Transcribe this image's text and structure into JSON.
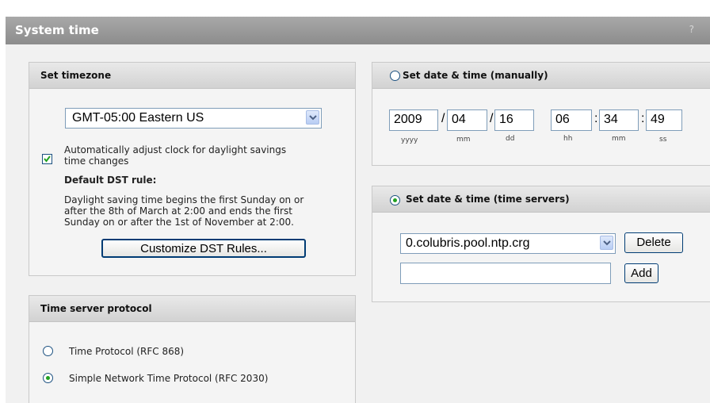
{
  "page": {
    "title": "System time",
    "help": "?"
  },
  "timezone": {
    "title": "Set timezone",
    "selected": "GMT-05:00 Eastern US",
    "auto_adjust_label_1": "Automatically adjust clock for daylight savings",
    "auto_adjust_label_2": "time changes",
    "auto_adjust_checked": true,
    "dst_heading": "Default DST rule:",
    "dst_text_1": "Daylight saving time begins the first Sunday on or",
    "dst_text_2": "after the 8th of March at 2:00 and ends the first",
    "dst_text_3": "Sunday on or after the 1st of November at 2:00.",
    "customize_button": "Customize DST Rules..."
  },
  "protocol": {
    "title": "Time server protocol",
    "options": [
      "Time Protocol (RFC 868)",
      "Simple Network Time Protocol (RFC 2030)"
    ],
    "selected_index": 1
  },
  "manual": {
    "title": "Set date & time (manually)",
    "selected": false,
    "year": "2009",
    "month": "04",
    "day": "16",
    "hour": "06",
    "minute": "34",
    "second": "49",
    "date_sep": "/",
    "time_sep": ":",
    "labels": {
      "year": "yyyy",
      "month": "mm",
      "day": "dd",
      "hour": "hh",
      "minute": "mm",
      "second": "ss"
    }
  },
  "servers": {
    "title": "Set date & time (time servers)",
    "selected": true,
    "server_value": "0.colubris.pool.ntp.crg",
    "delete_button": "Delete",
    "new_server_value": "",
    "add_button": "Add"
  }
}
